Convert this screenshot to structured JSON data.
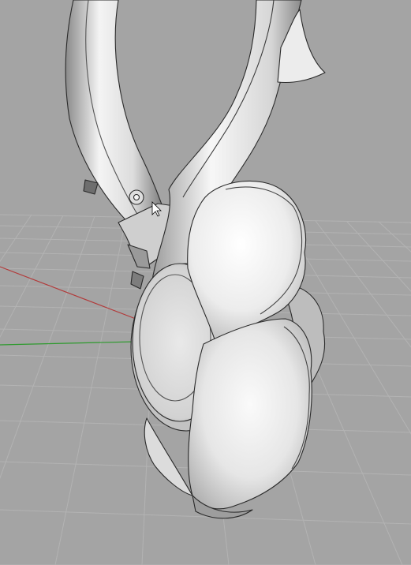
{
  "viewport": {
    "view_name": "",
    "display_mode": "shaded",
    "background_color": "#a4a4a4",
    "grid_color": "#b6b6b6",
    "grid_minor_color": "#adadad",
    "axis_colors": {
      "x": "#b23a3a",
      "y": "#2e9a2e"
    },
    "model": {
      "type": "3d-model",
      "object": "jewelry-pendant-with-hook",
      "surface_color": "#e8e8e8"
    },
    "cursor": {
      "shape": "arrow-pointer"
    }
  }
}
